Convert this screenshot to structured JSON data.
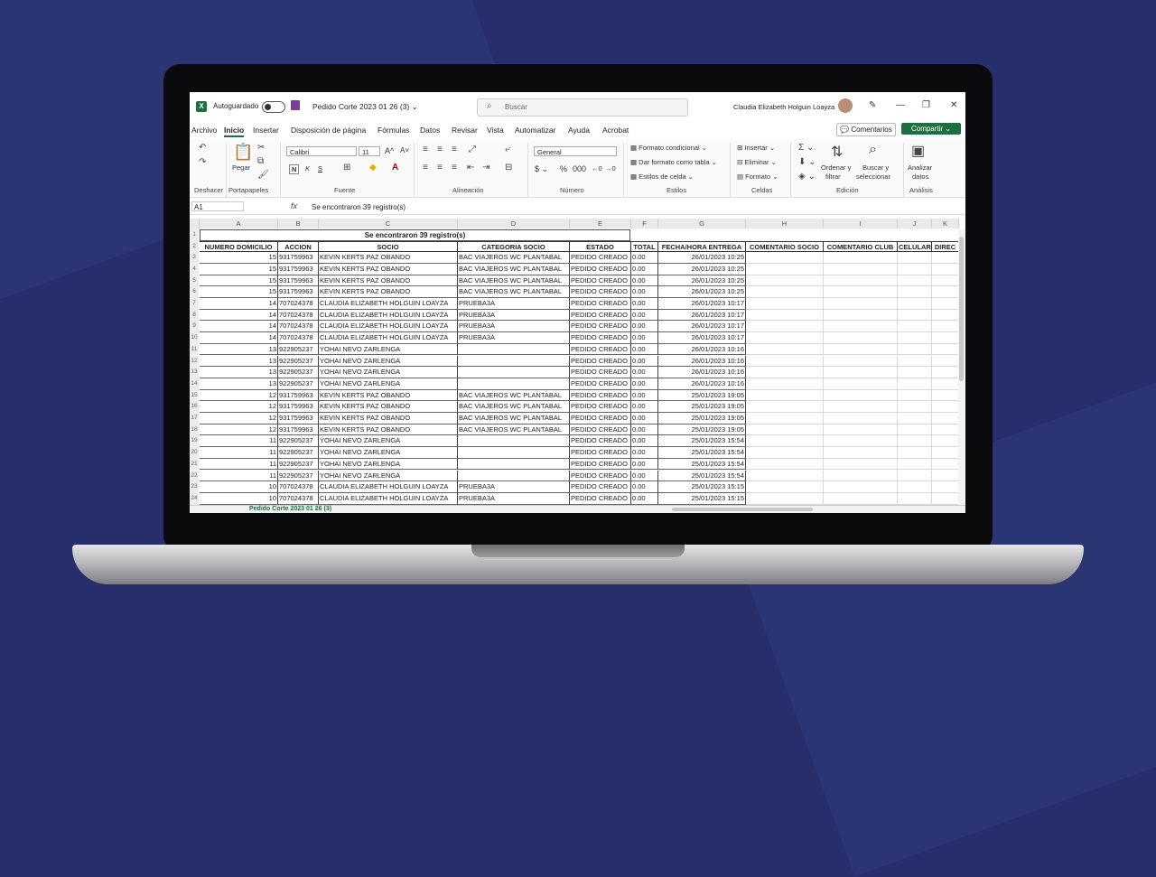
{
  "titlebar": {
    "autosave_label": "Autoguardado",
    "doc_title": "Pedido Corte 2023 01 26 (3) ⌄",
    "search_placeholder": "Buscar",
    "user_name": "Claudia Elizabeth Holguin Loayza"
  },
  "menu": [
    "Archivo",
    "Inicio",
    "Insertar",
    "Disposición de página",
    "Fórmulas",
    "Datos",
    "Revisar",
    "Vista",
    "Automatizar",
    "Ayuda",
    "Acrobat"
  ],
  "menu_active": "Inicio",
  "buttons": {
    "comments": "Comentarios",
    "share": "Compartir"
  },
  "ribbon": {
    "paste": "Pegar",
    "font_name": "Calibri",
    "font_size": "11",
    "bold": "N",
    "italic": "K",
    "underline": "S",
    "number_format": "General",
    "cond_format": "Formato condicional",
    "format_table": "Dar formato como tabla",
    "cell_styles": "Estilos de celda",
    "insert": "Insertar",
    "delete": "Eliminar",
    "format": "Formato",
    "sort_filter_1": "Ordenar y",
    "sort_filter_2": "filtrar",
    "find_select_1": "Buscar y",
    "find_select_2": "seleccionar",
    "analyze_1": "Analizar",
    "analyze_2": "datos",
    "groups": [
      "Deshacer",
      "Portapapeles",
      "Fuente",
      "Alineación",
      "Número",
      "Estilos",
      "Celdas",
      "Edición",
      "Análisis"
    ]
  },
  "formula_bar": {
    "name_box": "A1",
    "fx": "fx",
    "content": "Se encontraron 39 registro(s)"
  },
  "columns": [
    "A",
    "B",
    "C",
    "D",
    "E",
    "F",
    "G",
    "H",
    "I",
    "J",
    "K"
  ],
  "sheet": {
    "banner": "Se encontraron 39 registro(s)",
    "headers": [
      "NUMERO DOMICILIO",
      "ACCION",
      "SOCIO",
      "CATEGORIA SOCIO",
      "ESTADO",
      "TOTAL",
      "FECHA/HORA ENTREGA",
      "COMENTARIO SOCIO",
      "COMENTARIO CLUB",
      "CELULAR",
      "DIREC"
    ],
    "rows": [
      [
        "15",
        "931759963",
        "KEVIN KERTS PAZ OBANDO",
        "BAC VIAJEROS WC PLANTABAL",
        "PEDIDO CREADO",
        "0.00",
        "26/01/2023 10:25"
      ],
      [
        "15",
        "931759963",
        "KEVIN KERTS PAZ OBANDO",
        "BAC VIAJEROS WC PLANTABAL",
        "PEDIDO CREADO",
        "0.00",
        "26/01/2023 10:25"
      ],
      [
        "15",
        "931759963",
        "KEVIN KERTS PAZ OBANDO",
        "BAC VIAJEROS WC PLANTABAL",
        "PEDIDO CREADO",
        "0.00",
        "26/01/2023 10:25"
      ],
      [
        "15",
        "931759963",
        "KEVIN KERTS PAZ OBANDO",
        "BAC VIAJEROS WC PLANTABAL",
        "PEDIDO CREADO",
        "0.00",
        "26/01/2023 10:25"
      ],
      [
        "14",
        "707024378",
        "CLAUDIA ELIZABETH HOLGUIN LOAYZA",
        "PRUEBA3A",
        "PEDIDO CREADO",
        "0.00",
        "26/01/2023 10:17"
      ],
      [
        "14",
        "707024378",
        "CLAUDIA ELIZABETH HOLGUIN LOAYZA",
        "PRUEBA3A",
        "PEDIDO CREADO",
        "0.00",
        "26/01/2023 10:17"
      ],
      [
        "14",
        "707024378",
        "CLAUDIA ELIZABETH HOLGUIN LOAYZA",
        "PRUEBA3A",
        "PEDIDO CREADO",
        "0.00",
        "26/01/2023 10:17"
      ],
      [
        "14",
        "707024378",
        "CLAUDIA ELIZABETH HOLGUIN LOAYZA",
        "PRUEBA3A",
        "PEDIDO CREADO",
        "0.00",
        "26/01/2023 10:17"
      ],
      [
        "13",
        "922905237",
        "YOHAI NEVO ZARLENGA",
        "",
        "PEDIDO CREADO",
        "0.00",
        "26/01/2023 10:16"
      ],
      [
        "13",
        "922905237",
        "YOHAI NEVO ZARLENGA",
        "",
        "PEDIDO CREADO",
        "0.00",
        "26/01/2023 10:16"
      ],
      [
        "13",
        "922905237",
        "YOHAI NEVO ZARLENGA",
        "",
        "PEDIDO CREADO",
        "0.00",
        "26/01/2023 10:16"
      ],
      [
        "13",
        "922905237",
        "YOHAI NEVO ZARLENGA",
        "",
        "PEDIDO CREADO",
        "0.00",
        "26/01/2023 10:16"
      ],
      [
        "12",
        "931759963",
        "KEVIN KERTS PAZ OBANDO",
        "BAC VIAJEROS WC PLANTABAL",
        "PEDIDO CREADO",
        "0.00",
        "25/01/2023 19:05"
      ],
      [
        "12",
        "931759963",
        "KEVIN KERTS PAZ OBANDO",
        "BAC VIAJEROS WC PLANTABAL",
        "PEDIDO CREADO",
        "0.00",
        "25/01/2023 19:05"
      ],
      [
        "12",
        "931759963",
        "KEVIN KERTS PAZ OBANDO",
        "BAC VIAJEROS WC PLANTABAL",
        "PEDIDO CREADO",
        "0.00",
        "25/01/2023 19:05"
      ],
      [
        "12",
        "931759963",
        "KEVIN KERTS PAZ OBANDO",
        "BAC VIAJEROS WC PLANTABAL",
        "PEDIDO CREADO",
        "0.00",
        "25/01/2023 19:05"
      ],
      [
        "11",
        "922905237",
        "YOHAI NEVO ZARLENGA",
        "",
        "PEDIDO CREADO",
        "0.00",
        "25/01/2023 15:54"
      ],
      [
        "11",
        "922905237",
        "YOHAI NEVO ZARLENGA",
        "",
        "PEDIDO CREADO",
        "0.00",
        "25/01/2023 15:54"
      ],
      [
        "11",
        "922905237",
        "YOHAI NEVO ZARLENGA",
        "",
        "PEDIDO CREADO",
        "0.00",
        "25/01/2023 15:54"
      ],
      [
        "11",
        "922905237",
        "YOHAI NEVO ZARLENGA",
        "",
        "PEDIDO CREADO",
        "0.00",
        "25/01/2023 15:54"
      ],
      [
        "10",
        "707024378",
        "CLAUDIA ELIZABETH HOLGUIN LOAYZA",
        "PRUEBA3A",
        "PEDIDO CREADO",
        "0.00",
        "25/01/2023 15:15"
      ],
      [
        "10",
        "707024378",
        "CLAUDIA ELIZABETH HOLGUIN LOAYZA",
        "PRUEBA3A",
        "PEDIDO CREADO",
        "0.00",
        "25/01/2023 15:15"
      ]
    ],
    "row_numbers": [
      "1",
      "2",
      "3",
      "4",
      "5",
      "6",
      "7",
      "8",
      "9",
      "10",
      "11",
      "12",
      "13",
      "14",
      "15",
      "16",
      "17",
      "18",
      "19",
      "20",
      "21",
      "22",
      "23",
      "24"
    ],
    "sheet_tab": "Pedido Corte 2023 01 26 (3)"
  },
  "colors": {
    "excel_green": "#1d6f42",
    "background": "#262f6b"
  }
}
